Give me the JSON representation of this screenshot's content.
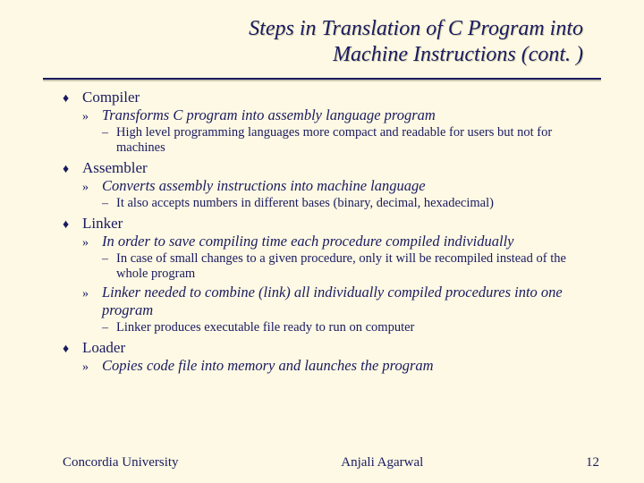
{
  "title": {
    "line1": "Steps in Translation of C Program into",
    "line2": "Machine Instructions (cont. )"
  },
  "sections": [
    {
      "name": "Compiler",
      "subs": [
        {
          "text": "Transforms C program into assembly language program",
          "details": [
            "High level programming languages more compact and readable for users but not for machines"
          ]
        }
      ]
    },
    {
      "name": "Assembler",
      "subs": [
        {
          "text": "Converts assembly instructions into machine language",
          "details": [
            "It also accepts numbers in different bases (binary, decimal, hexadecimal)"
          ]
        }
      ]
    },
    {
      "name": "Linker",
      "subs": [
        {
          "text": "In order to save compiling time each procedure compiled individually",
          "details": [
            "In case of small changes to a given procedure, only it will be recompiled instead of the whole program"
          ]
        },
        {
          "text": "Linker needed to combine (link) all individually compiled procedures into one program",
          "details": [
            "Linker produces executable file ready to run on computer"
          ]
        }
      ]
    },
    {
      "name": "Loader",
      "subs": [
        {
          "text": "Copies code file into memory and launches the program",
          "details": []
        }
      ]
    }
  ],
  "footer": {
    "left": "Concordia University",
    "center": "Anjali Agarwal",
    "right": "12"
  },
  "bullets": {
    "level1": "♦",
    "level2": "»",
    "dash": "–"
  }
}
